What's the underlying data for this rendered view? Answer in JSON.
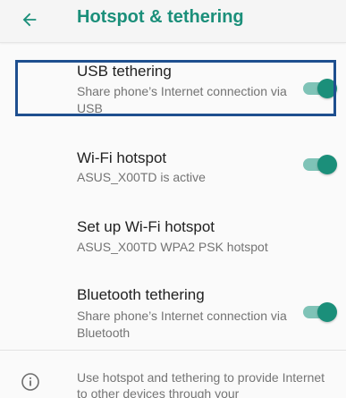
{
  "header": {
    "title": "Hotspot & tethering",
    "back_icon": "arrow-left-icon"
  },
  "colors": {
    "accent": "#1b8f7a",
    "switch_track": "#7fc3b7",
    "highlight_border": "#1e4f8f"
  },
  "settings": [
    {
      "title": "USB tethering",
      "summary": "Share phone’s Internet connection via USB",
      "switch_on": true
    },
    {
      "title": "Wi-Fi hotspot",
      "summary": "ASUS_X00TD is active",
      "switch_on": true
    },
    {
      "title": "Set up Wi-Fi hotspot",
      "summary": "ASUS_X00TD WPA2 PSK hotspot"
    },
    {
      "title": "Bluetooth tethering",
      "summary": "Share phone’s Internet connection via Bluetooth",
      "switch_on": true
    }
  ],
  "footer": {
    "icon": "info-icon",
    "text": "Use hotspot and tethering to provide Internet to other devices through your"
  }
}
